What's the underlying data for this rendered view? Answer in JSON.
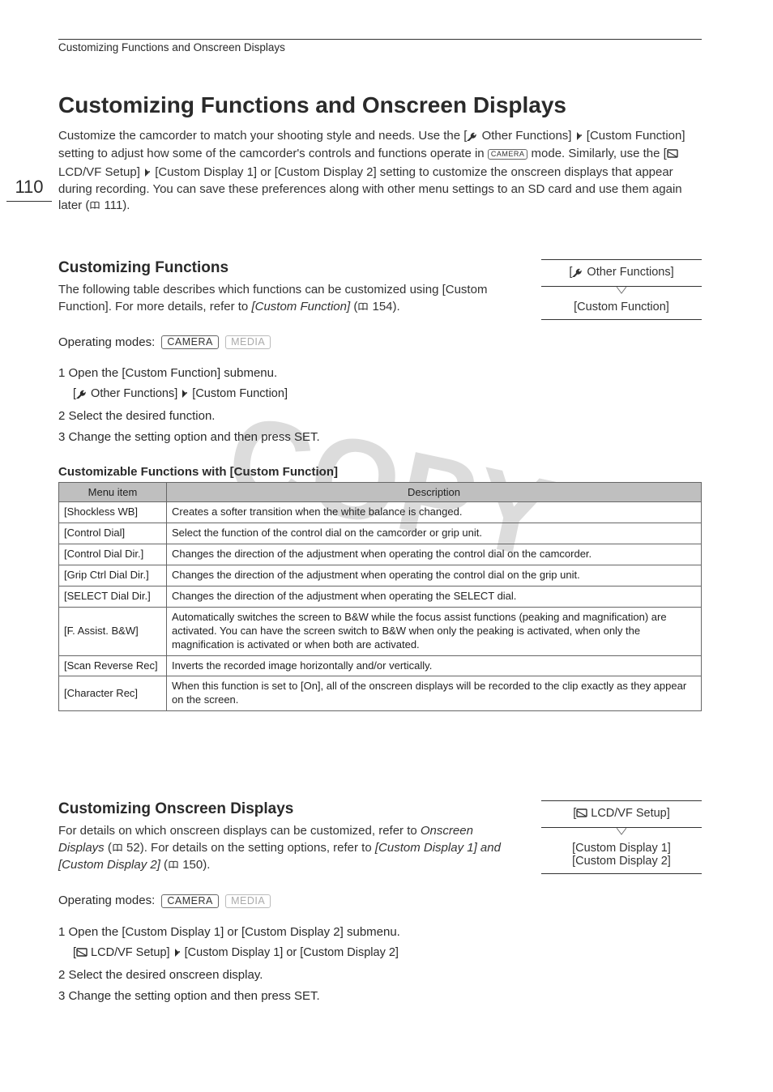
{
  "breadcrumb": "Customizing Functions and Onscreen Displays",
  "page_number": "110",
  "watermark": "COPY",
  "h1": "Customizing Functions and Onscreen Displays",
  "intro": {
    "p1a": "Customize the camcorder to match your shooting style and needs. Use the [",
    "p1b": " Other Functions] ",
    "p1c": " [Custom Function] setting to adjust how some of the camcorder's controls and functions operate in ",
    "p1d": " mode. Similarly, use the [",
    "p1e": " LCD/VF Setup] ",
    "p1f": " [Custom Display 1] or [Custom Display 2] setting to customize the onscreen displays that appear during recording. You can save these preferences along with other menu settings to an SD card and use them again later (",
    "p1g": " 111)."
  },
  "camera_label": "CAMERA",
  "sec1": {
    "h2": "Customizing Functions",
    "p_a": "The following table describes which functions can be customized using [Custom Function]. For more details, refer to ",
    "p_b": "[Custom Function]",
    "p_c": " (",
    "p_d": " 154).",
    "menu_top": " Other Functions]",
    "menu_top_prefix": "[",
    "menu_bottom": "[Custom Function]",
    "opmodes_label": "Operating modes:",
    "mode_camera": "CAMERA",
    "mode_media": "MEDIA",
    "steps": {
      "s1": "1 Open the [Custom Function] submenu.",
      "s1sub_a": "[",
      "s1sub_b": " Other Functions] ",
      "s1sub_c": " [Custom Function]",
      "s2": "2 Select the desired function.",
      "s3": "3 Change the setting option and then press SET."
    },
    "table_caption": "Customizable Functions with [Custom Function]",
    "th1": "Menu item",
    "th2": "Description",
    "rows": [
      {
        "item": "[Shockless WB]",
        "desc": "Creates a softer transition when the white balance is changed."
      },
      {
        "item": "[Control Dial]",
        "desc": "Select the function of the control dial on the camcorder or grip unit."
      },
      {
        "item": "[Control Dial Dir.]",
        "desc": "Changes the direction of the adjustment when operating the control dial on the camcorder."
      },
      {
        "item": "[Grip Ctrl Dial Dir.]",
        "desc": "Changes the direction of the adjustment when operating the control dial on the grip unit."
      },
      {
        "item": "[SELECT Dial Dir.]",
        "desc": "Changes the direction of the adjustment when operating the SELECT dial."
      },
      {
        "item": "[F. Assist. B&W]",
        "desc": "Automatically switches the screen to B&W while the focus assist functions (peaking and magnification) are activated. You can have the screen switch to B&W when only the peaking is activated, when only the magnification is activated or when both are activated."
      },
      {
        "item": "[Scan Reverse Rec]",
        "desc": "Inverts the recorded image horizontally and/or vertically."
      },
      {
        "item": "[Character Rec]",
        "desc": "When this function is set to [On], all of the onscreen displays will be recorded to the clip exactly as they appear on the screen."
      }
    ]
  },
  "sec2": {
    "h2": "Customizing Onscreen Displays",
    "p_a": "For details on which onscreen displays can be customized, refer to ",
    "p_b": "Onscreen Displays",
    "p_c": " (",
    "p_d": " 52). For details on the setting options, refer to ",
    "p_e": "[Custom Display 1] and [Custom Display 2]",
    "p_f": " (",
    "p_g": " 150).",
    "menu_top_prefix": "[",
    "menu_top": " LCD/VF Setup]",
    "menu_b1": "[Custom Display 1]",
    "menu_b2": "[Custom Display 2]",
    "opmodes_label": "Operating modes:",
    "mode_camera": "CAMERA",
    "mode_media": "MEDIA",
    "steps": {
      "s1": "1 Open the [Custom Display 1] or [Custom Display 2] submenu.",
      "s1sub_a": "[",
      "s1sub_b": " LCD/VF Setup] ",
      "s1sub_c": " [Custom Display 1] or [Custom Display 2]",
      "s2": "2 Select the desired onscreen display.",
      "s3": "3 Change the setting option and then press SET."
    }
  }
}
